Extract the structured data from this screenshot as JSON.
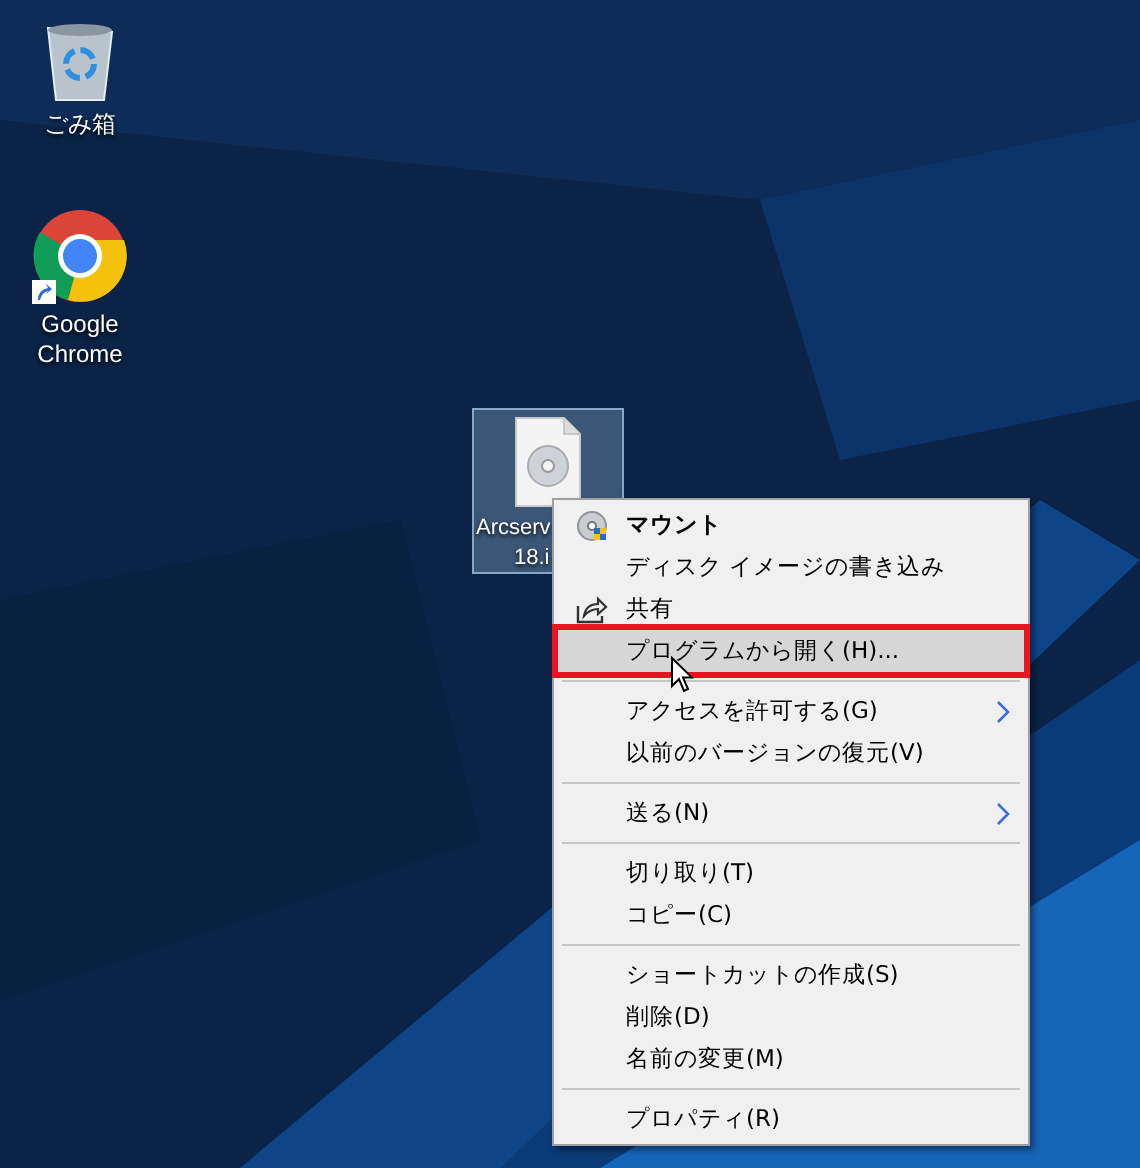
{
  "desktop_icons": [
    {
      "kind": "recycle",
      "label_lines": [
        "ごみ箱"
      ],
      "selected": false,
      "shortcut": false
    },
    {
      "kind": "chrome",
      "label_lines": [
        "Google",
        "Chrome"
      ],
      "selected": false,
      "shortcut": true
    },
    {
      "kind": "disc-file",
      "label_lines": [
        "Arcserv",
        "18.i"
      ],
      "selected": true,
      "shortcut": false
    }
  ],
  "context_menu": {
    "items": [
      {
        "kind": "disc",
        "label": "マウント",
        "default": true,
        "selected": false,
        "outlined": false
      },
      {
        "kind": "plain",
        "label": "ディスク イメージの書き込み",
        "default": false,
        "selected": false,
        "outlined": false
      },
      {
        "kind": "share",
        "label": "共有",
        "default": false,
        "selected": false,
        "outlined": false
      },
      {
        "kind": "plain",
        "label": "プログラムから開く(H)...",
        "default": false,
        "selected": true,
        "outlined": true
      },
      {
        "kind": "separator"
      },
      {
        "kind": "submenu",
        "label": "アクセスを許可する(G)",
        "default": false,
        "selected": false,
        "outlined": false
      },
      {
        "kind": "plain",
        "label": "以前のバージョンの復元(V)",
        "default": false,
        "selected": false,
        "outlined": false
      },
      {
        "kind": "separator"
      },
      {
        "kind": "submenu",
        "label": "送る(N)",
        "default": false,
        "selected": false,
        "outlined": false
      },
      {
        "kind": "separator"
      },
      {
        "kind": "plain",
        "label": "切り取り(T)",
        "default": false,
        "selected": false,
        "outlined": false
      },
      {
        "kind": "plain",
        "label": "コピー(C)",
        "default": false,
        "selected": false,
        "outlined": false
      },
      {
        "kind": "separator"
      },
      {
        "kind": "plain",
        "label": "ショートカットの作成(S)",
        "default": false,
        "selected": false,
        "outlined": false
      },
      {
        "kind": "plain",
        "label": "削除(D)",
        "default": false,
        "selected": false,
        "outlined": false
      },
      {
        "kind": "plain",
        "label": "名前の変更(M)",
        "default": false,
        "selected": false,
        "outlined": false
      },
      {
        "kind": "separator"
      },
      {
        "kind": "plain",
        "label": "プロパティ(R)",
        "default": false,
        "selected": false,
        "outlined": false
      }
    ]
  }
}
